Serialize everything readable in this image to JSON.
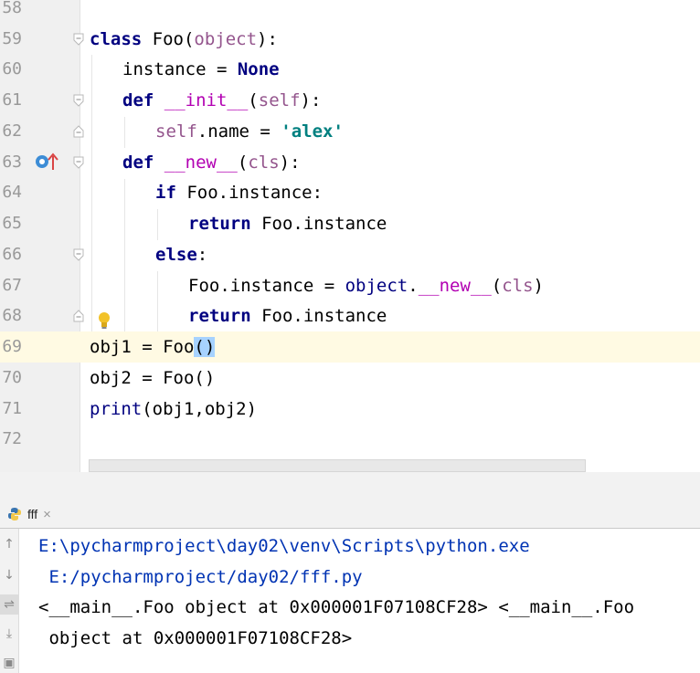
{
  "editor": {
    "line_numbers": [
      "58",
      "59",
      "60",
      "61",
      "62",
      "63",
      "64",
      "65",
      "66",
      "67",
      "68",
      "69",
      "70",
      "71",
      "72"
    ],
    "code": {
      "l59": {
        "kw": "class",
        "name": " Foo(",
        "base": "object",
        "end": "):"
      },
      "l60": {
        "name": "instance = ",
        "kw": "None"
      },
      "l61": {
        "kw": "def",
        "sp": " ",
        "magic": "__init__",
        "open": "(",
        "self": "self",
        "end": "):"
      },
      "l62": {
        "self": "self",
        "mid": ".name = ",
        "str": "'alex'"
      },
      "l63": {
        "kw": "def",
        "sp": " ",
        "magic": "__new__",
        "open": "(",
        "self": "cls",
        "end": "):"
      },
      "l64": {
        "kw": "if",
        "rest": " Foo.instance:"
      },
      "l65": {
        "kw": "return",
        "rest": " Foo.instance"
      },
      "l66": {
        "kw": "else",
        "rest": ":"
      },
      "l67": {
        "pre": "Foo.instance = ",
        "bi": "object",
        "dot": ".",
        "magic": "__new__",
        "open": "(",
        "self": "cls",
        "end": ")"
      },
      "l68": {
        "kw": "return",
        "rest": " Foo.instance"
      },
      "l69": {
        "pre": "obj1 = Foo",
        "sel": "()"
      },
      "l70": {
        "text": "obj2 = Foo()"
      },
      "l71": {
        "bi": "print",
        "rest": "(obj1,obj2)"
      }
    },
    "gutter_icons": {
      "override": "override-icon",
      "bulb": "lightbulb-icon"
    }
  },
  "run_panel": {
    "tab_label": "fff",
    "tab_icon": "python-icon",
    "close_glyph": "×",
    "toolbar_icons": [
      "up-arrow-icon",
      "down-arrow-icon",
      "soft-wrap-icon",
      "scroll-to-end-icon",
      "print-icon"
    ],
    "output": [
      "E:\\pycharmproject\\day02\\venv\\Scripts\\python.exe",
      " E:/pycharmproject/day02/fff.py",
      "<__main__.Foo object at 0x000001F07108CF28> <__main__.Foo",
      " object at 0x000001F07108CF28>"
    ]
  },
  "colors": {
    "keyword": "#000080",
    "self": "#94558d",
    "magic": "#b200b2",
    "string": "#008080",
    "console_path": "#0033b3",
    "current_line": "#fffae3"
  }
}
